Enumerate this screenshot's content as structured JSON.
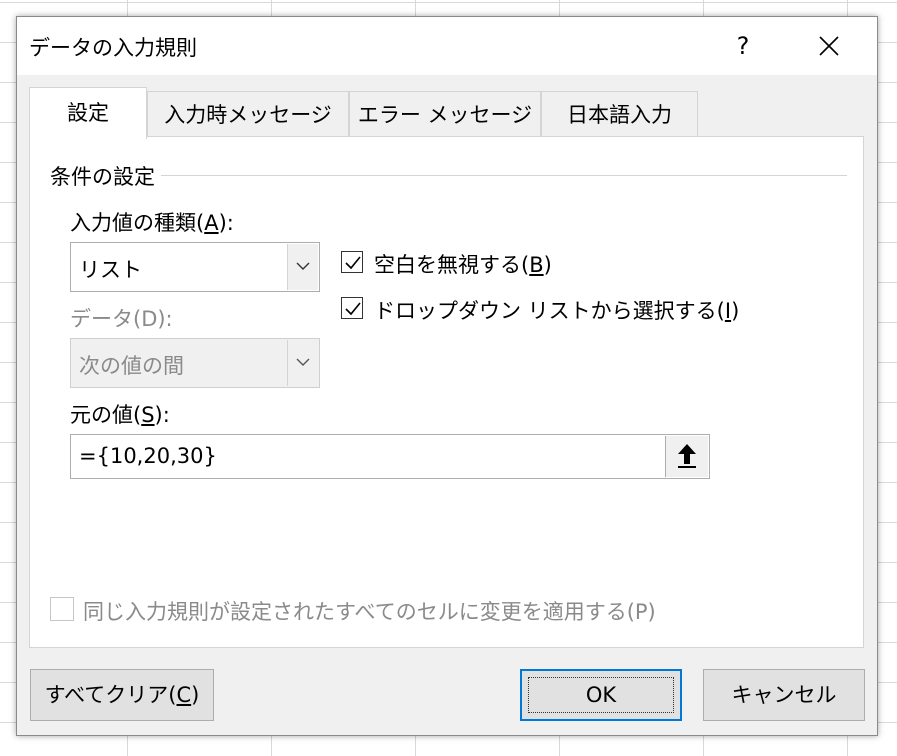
{
  "dialog": {
    "title": "データの入力規則",
    "help": "?"
  },
  "tabs": [
    {
      "label": "設定",
      "active": true
    },
    {
      "label": "入力時メッセージ",
      "active": false
    },
    {
      "label": "エラー メッセージ",
      "active": false
    },
    {
      "label": "日本語入力",
      "active": false
    }
  ],
  "settings": {
    "group_label": "条件の設定",
    "allow_label_pre": "入力値の種類(",
    "allow_label_key": "A",
    "allow_label_post": "):",
    "allow_value": "リスト",
    "data_label": "データ(D):",
    "data_value": "次の値の間",
    "ignore_blank_pre": "空白を無視する(",
    "ignore_blank_key": "B",
    "ignore_blank_post": ")",
    "ignore_blank_checked": true,
    "dropdown_pre": "ドロップダウン リストから選択する(",
    "dropdown_key": "I",
    "dropdown_post": ")",
    "dropdown_checked": true,
    "source_label_pre": "元の値(",
    "source_label_key": "S",
    "source_label_post": "):",
    "source_value": "={10,20,30}",
    "apply_all": "同じ入力規則が設定されたすべてのセルに変更を適用する(P)",
    "apply_all_checked": false
  },
  "buttons": {
    "clear_pre": "すべてクリア(",
    "clear_key": "C",
    "clear_post": ")",
    "ok": "OK",
    "cancel": "キャンセル"
  },
  "icons": {
    "close": "close-icon",
    "dropdown": "chevron-down-icon",
    "check": "check-icon",
    "range_select": "arrow-up-icon"
  }
}
